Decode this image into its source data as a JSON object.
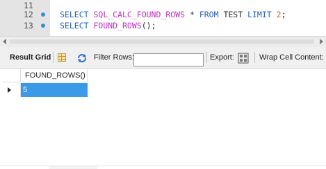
{
  "editor": {
    "lines": [
      {
        "number": "11",
        "executed": false
      },
      {
        "number": "12",
        "executed": true,
        "tokens": [
          {
            "text": "SELECT ",
            "kind": "kw"
          },
          {
            "text": "SQL_CALC_FOUND_ROWS",
            "kind": "fn"
          },
          {
            "text": " * ",
            "kind": "plain"
          },
          {
            "text": "FROM",
            "kind": "kw"
          },
          {
            "text": " TEST ",
            "kind": "plain"
          },
          {
            "text": "LIMIT",
            "kind": "kw"
          },
          {
            "text": " ",
            "kind": "plain"
          },
          {
            "text": "2",
            "kind": "num"
          },
          {
            "text": ";",
            "kind": "plain"
          }
        ]
      },
      {
        "number": "13",
        "executed": true,
        "tokens": [
          {
            "text": "SELECT ",
            "kind": "kw"
          },
          {
            "text": "FOUND_ROWS",
            "kind": "fn"
          },
          {
            "text": "();",
            "kind": "plain"
          }
        ]
      }
    ]
  },
  "toolbar": {
    "result_grid_label": "Result Grid",
    "filter_rows_label": "Filter Rows:",
    "filter_rows_value": "",
    "export_label": "Export:",
    "wrap_cell_label": "Wrap Cell Content:"
  },
  "grid": {
    "columns": [
      "FOUND_ROWS()"
    ],
    "rows": [
      [
        "5"
      ]
    ]
  },
  "colors": {
    "keyword": "#1f5fb8",
    "function": "#c02fc0",
    "number": "#d9622b",
    "selection": "#3b9ae8",
    "exec_dot": "#3b8cd8"
  },
  "icons": [
    "grid-view-icon",
    "refresh-icon",
    "export-icon",
    "row-pointer-icon",
    "scroll-left-icon",
    "scroll-right-icon"
  ]
}
